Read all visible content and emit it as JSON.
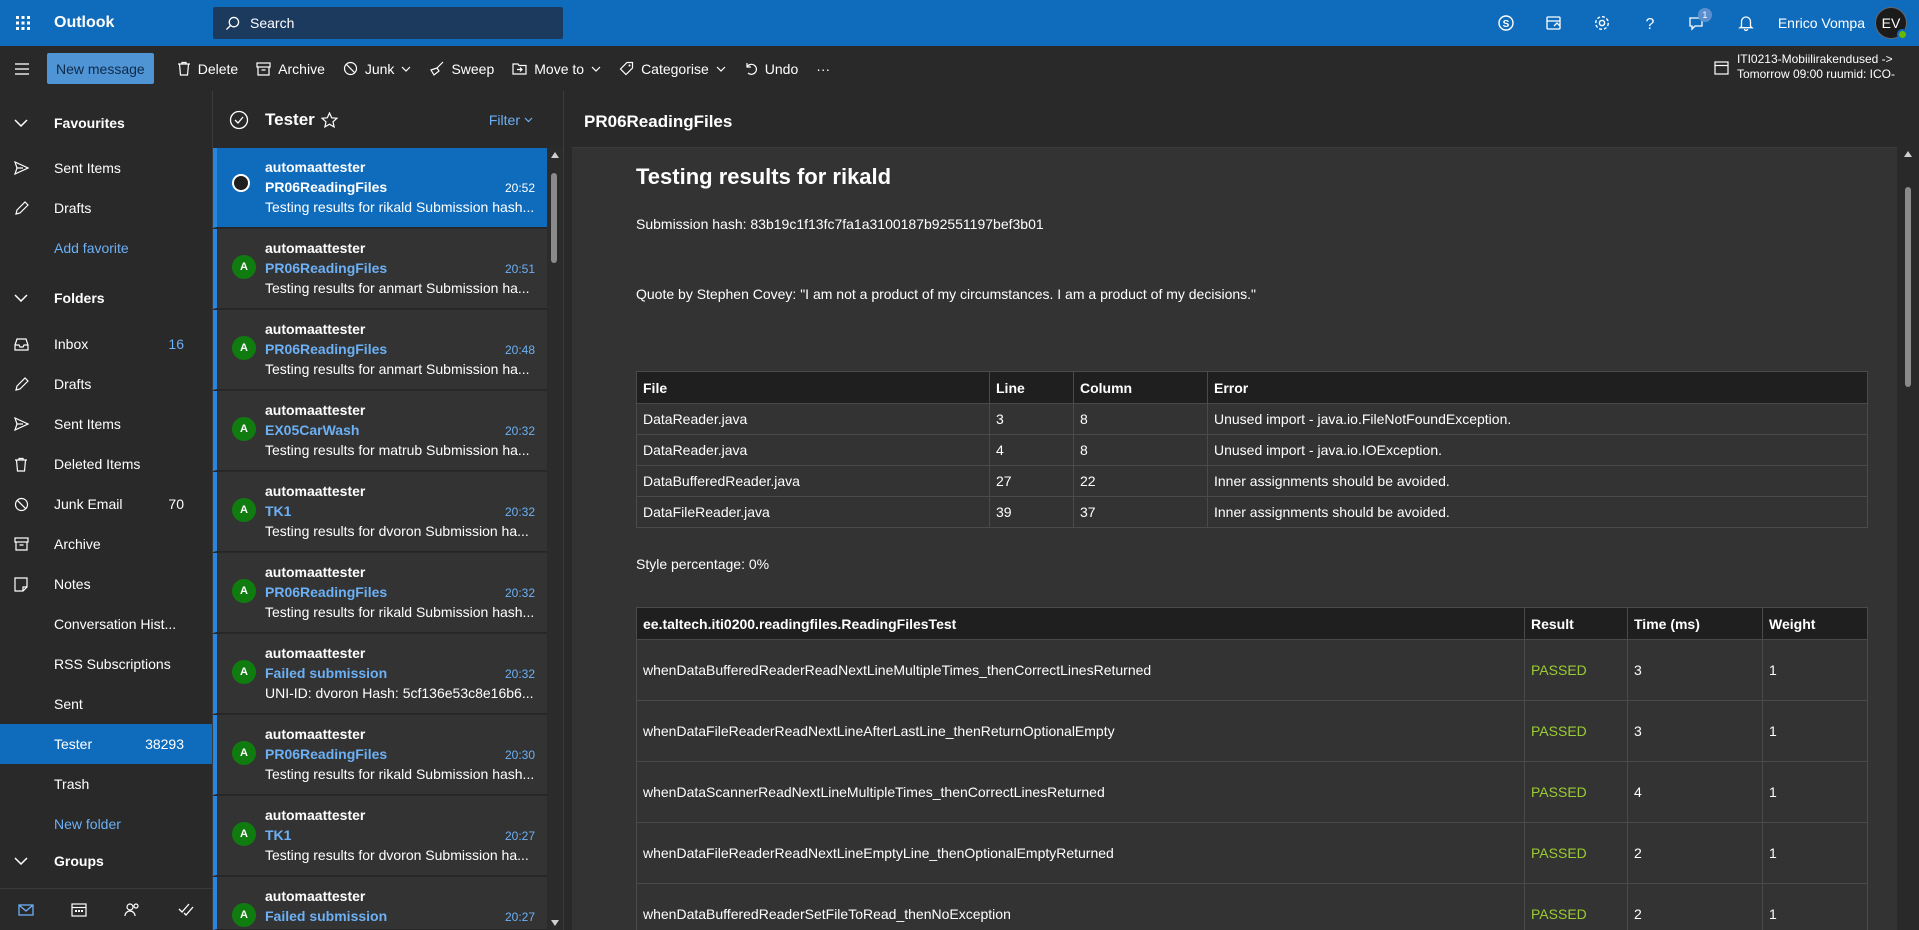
{
  "app": {
    "title": "Outlook"
  },
  "search": {
    "label": "Search"
  },
  "user": {
    "name": "Enrico Vompa",
    "initials": "EV",
    "notification_count": "1"
  },
  "toolbar": {
    "new_message": "New message",
    "delete": "Delete",
    "archive": "Archive",
    "junk": "Junk",
    "sweep": "Sweep",
    "move_to": "Move to",
    "categorise": "Categorise",
    "undo": "Undo",
    "more": "···"
  },
  "reminder": {
    "line1": "ITI0213-Mobiilirakendused ->",
    "line2": "Tomorrow 09:00 ruumid: ICO-"
  },
  "nav": {
    "favourites": "Favourites",
    "fav_sent": "Sent Items",
    "fav_drafts": "Drafts",
    "add_favorite": "Add favorite",
    "folders": "Folders",
    "inbox": "Inbox",
    "inbox_count": "16",
    "drafts": "Drafts",
    "sent_items": "Sent Items",
    "deleted": "Deleted Items",
    "junk": "Junk Email",
    "junk_count": "70",
    "archive": "Archive",
    "notes": "Notes",
    "conversation": "Conversation Hist...",
    "rss": "RSS Subscriptions",
    "sent": "Sent",
    "tester": "Tester",
    "tester_count": "38293",
    "trash": "Trash",
    "new_folder": "New folder",
    "groups": "Groups"
  },
  "list": {
    "folder_title": "Tester",
    "filter": "Filter",
    "messages": [
      {
        "avatar": "",
        "sender": "automaattester",
        "subject": "PR06ReadingFiles",
        "time": "20:52",
        "preview": "Testing results for rikald Submission hash..."
      },
      {
        "avatar": "A",
        "sender": "automaattester",
        "subject": "PR06ReadingFiles",
        "time": "20:51",
        "preview": "Testing results for anmart Submission ha..."
      },
      {
        "avatar": "A",
        "sender": "automaattester",
        "subject": "PR06ReadingFiles",
        "time": "20:48",
        "preview": "Testing results for anmart Submission ha..."
      },
      {
        "avatar": "A",
        "sender": "automaattester",
        "subject": "EX05CarWash",
        "time": "20:32",
        "preview": "Testing results for matrub Submission ha..."
      },
      {
        "avatar": "A",
        "sender": "automaattester",
        "subject": "TK1",
        "time": "20:32",
        "preview": "Testing results for dvoron Submission ha..."
      },
      {
        "avatar": "A",
        "sender": "automaattester",
        "subject": "PR06ReadingFiles",
        "time": "20:32",
        "preview": "Testing results for rikald Submission hash..."
      },
      {
        "avatar": "A",
        "sender": "automaattester",
        "subject": "Failed submission",
        "time": "20:32",
        "preview": "UNI-ID: dvoron Hash: 5cf136e53c8e16b6..."
      },
      {
        "avatar": "A",
        "sender": "automaattester",
        "subject": "PR06ReadingFiles",
        "time": "20:30",
        "preview": "Testing results for rikald Submission hash..."
      },
      {
        "avatar": "A",
        "sender": "automaattester",
        "subject": "TK1",
        "time": "20:27",
        "preview": "Testing results for dvoron Submission ha..."
      },
      {
        "avatar": "A",
        "sender": "automaattester",
        "subject": "Failed submission",
        "time": "20:27",
        "preview": ""
      }
    ]
  },
  "reading": {
    "subject": "PR06ReadingFiles",
    "heading": "Testing results for rikald",
    "hash_line": "Submission hash: 83b19c1f13fc7fa1a3100187b92551197bef3b01",
    "quote": "Quote by Stephen Covey: \"I am not a product of my circumstances. I am a product of my decisions.\"",
    "style_table": {
      "headers": [
        "File",
        "Line",
        "Column",
        "Error"
      ],
      "rows": [
        [
          "DataReader.java",
          "3",
          "8",
          "Unused import - java.io.FileNotFoundException."
        ],
        [
          "DataReader.java",
          "4",
          "8",
          "Unused import - java.io.IOException."
        ],
        [
          "DataBufferedReader.java",
          "27",
          "22",
          "Inner assignments should be avoided."
        ],
        [
          "DataFileReader.java",
          "39",
          "37",
          "Inner assignments should be avoided."
        ]
      ]
    },
    "style_percentage": "Style percentage: 0%",
    "test_table": {
      "headers": [
        "ee.taltech.iti0200.readingfiles.ReadingFilesTest",
        "Result",
        "Time (ms)",
        "Weight"
      ],
      "rows": [
        [
          "whenDataBufferedReaderReadNextLineMultipleTimes_thenCorrectLinesReturned",
          "PASSED",
          "3",
          "1"
        ],
        [
          "whenDataFileReaderReadNextLineAfterLastLine_thenReturnOptionalEmpty",
          "PASSED",
          "3",
          "1"
        ],
        [
          "whenDataScannerReadNextLineMultipleTimes_thenCorrectLinesReturned",
          "PASSED",
          "4",
          "1"
        ],
        [
          "whenDataFileReaderReadNextLineEmptyLine_thenOptionalEmptyReturned",
          "PASSED",
          "2",
          "1"
        ],
        [
          "whenDataBufferedReaderSetFileToRead_thenNoException",
          "PASSED",
          "2",
          "1"
        ]
      ]
    }
  },
  "colors": {
    "brand": "#0f6cbd",
    "link": "#6cb0f5",
    "passed": "#9acd32",
    "avatar": "#107c10"
  }
}
